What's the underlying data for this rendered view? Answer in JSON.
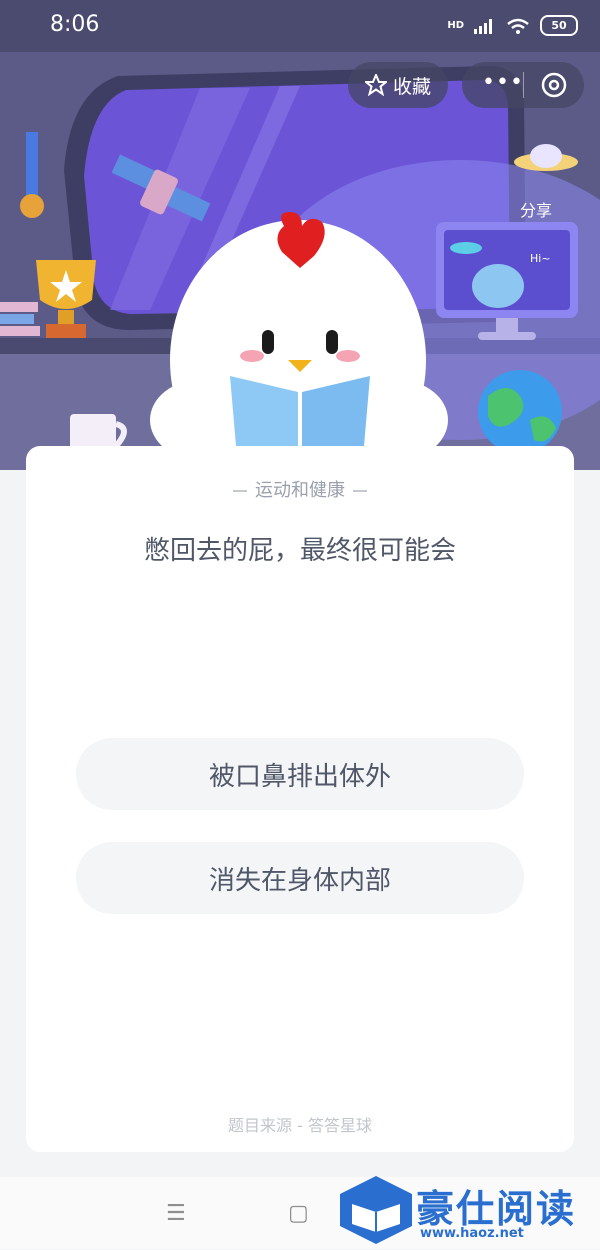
{
  "status_bar": {
    "time": "8:06",
    "network": "HD",
    "battery": "50"
  },
  "header": {
    "favorite_label": "收藏",
    "share_label": "分享"
  },
  "screen_text": "Hi~",
  "card": {
    "category": "运动和健康",
    "question": "憋回去的屁，最终很可能会",
    "options": [
      "被口鼻排出体外",
      "消失在身体内部"
    ],
    "source": "题目来源 - 答答星球"
  },
  "nav": {
    "menu_glyph": "☰",
    "home_glyph": "▢"
  },
  "watermark": {
    "text": "豪仕阅读",
    "url": "www.haoz.net"
  },
  "colors": {
    "accent": "#6b55d6",
    "hero_bg": "#5a5a86",
    "card_text": "#4f5768"
  }
}
